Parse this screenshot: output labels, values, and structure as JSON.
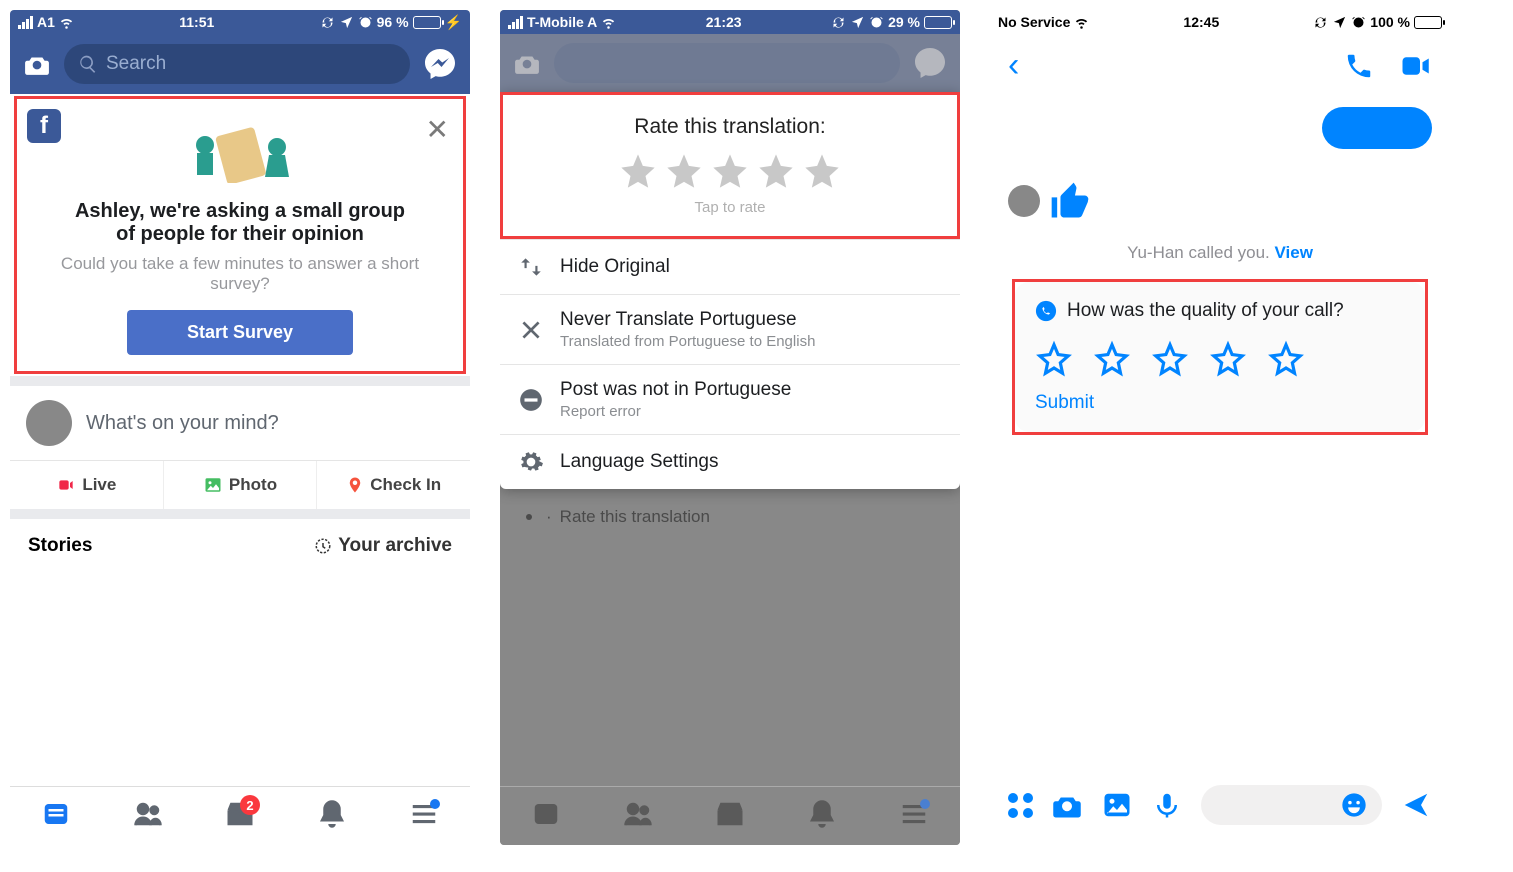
{
  "screen1": {
    "status": {
      "carrier": "A1",
      "time": "11:51",
      "battery_pct": "96 %"
    },
    "search_placeholder": "Search",
    "survey": {
      "title": "Ashley, we're asking a small group of people for their opinion",
      "subtitle": "Could you take a few minutes to answer a short survey?",
      "button": "Start Survey"
    },
    "composer": "What's on your mind?",
    "actions": {
      "live": "Live",
      "photo": "Photo",
      "checkin": "Check In"
    },
    "stories": "Stories",
    "archive": "Your archive",
    "badge_count": "2"
  },
  "screen2": {
    "status": {
      "carrier": "T-Mobile A",
      "time": "21:23",
      "battery_pct": "29 %"
    },
    "rate_title": "Rate this translation:",
    "rate_hint": "Tap to rate",
    "options": {
      "hide": "Hide Original",
      "never_t": "Never Translate Portuguese",
      "never_s": "Translated from Portuguese to English",
      "notlang_t": "Post was not in Portuguese",
      "notlang_s": "Report error",
      "settings": "Language Settings"
    },
    "below": "Rate this translation"
  },
  "screen3": {
    "status": {
      "carrier": "No Service",
      "time": "12:45",
      "battery_pct": "100 %"
    },
    "called_text": "Yu-Han called you. ",
    "called_link": "View",
    "card_title": "How was the quality of your call?",
    "submit": "Submit"
  }
}
